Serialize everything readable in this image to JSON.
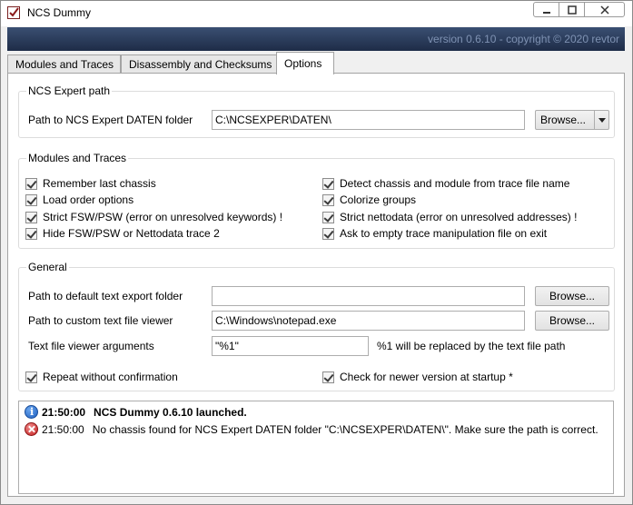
{
  "window": {
    "title": "NCS Dummy",
    "version_banner": "version 0.6.10 - copyright © 2020 revtor",
    "controls": {
      "minimize": "—",
      "maximize": "☐",
      "close": "✕"
    }
  },
  "tabs": [
    {
      "label": "Modules and Traces",
      "active": false
    },
    {
      "label": "Disassembly and Checksums",
      "active": false
    },
    {
      "label": "Options",
      "active": true
    }
  ],
  "ncs_expert": {
    "group_title": "NCS Expert path",
    "folder_label": "Path to NCS Expert DATEN folder",
    "folder_value": "C:\\NCSEXPER\\DATEN\\",
    "browse_label": "Browse..."
  },
  "modules_traces": {
    "group_title": "Modules and Traces",
    "left": [
      {
        "label": "Remember last chassis",
        "checked": true
      },
      {
        "label": "Load order options",
        "checked": true
      },
      {
        "label": "Strict FSW/PSW (error on unresolved keywords) !",
        "checked": true
      },
      {
        "label": "Hide FSW/PSW or Nettodata trace 2",
        "checked": true
      }
    ],
    "right": [
      {
        "label": "Detect chassis and module from trace file name",
        "checked": true
      },
      {
        "label": "Colorize groups",
        "checked": true
      },
      {
        "label": "Strict nettodata (error on unresolved addresses) !",
        "checked": true
      },
      {
        "label": "Ask to empty trace manipulation file on exit",
        "checked": true
      }
    ]
  },
  "general": {
    "group_title": "General",
    "export_label": "Path to default text export folder",
    "export_value": "",
    "export_browse": "Browse...",
    "viewer_label": "Path to custom text file viewer",
    "viewer_value": "C:\\Windows\\notepad.exe",
    "viewer_browse": "Browse...",
    "args_label": "Text file viewer arguments",
    "args_value": "\"%1\"",
    "args_hint": "%1 will be replaced by the text file path",
    "repeat": {
      "label": "Repeat without confirmation",
      "checked": true
    },
    "check_version": {
      "label": "Check for newer version at startup *",
      "checked": true
    }
  },
  "log": [
    {
      "type": "info",
      "icon": "info-icon",
      "time": "21:50:00",
      "message": "NCS Dummy 0.6.10 launched."
    },
    {
      "type": "error",
      "icon": "error-icon",
      "time": "21:50:00",
      "message": "No chassis found for NCS Expert DATEN folder \"C:\\NCSEXPER\\DATEN\\\". Make sure the path is correct."
    }
  ],
  "colors": {
    "banner": "#1e2c47",
    "banner_text": "#7f92b3",
    "info": "#1f5fbf",
    "error": "#c42020"
  }
}
